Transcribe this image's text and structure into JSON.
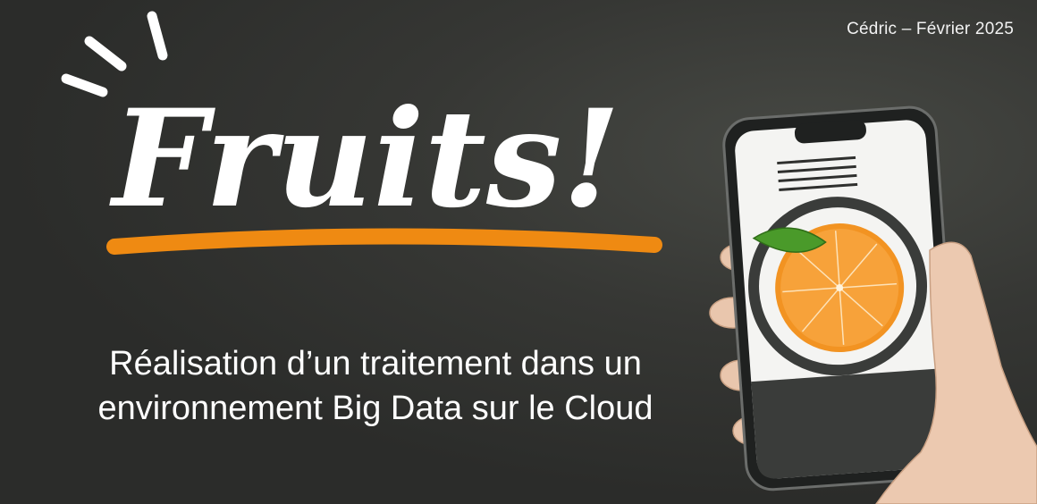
{
  "slide": {
    "author_date": "Cédric – Février 2025",
    "logo_text": "Fruits!",
    "subtitle_lines": [
      "Réalisation d’un traitement dans un",
      "environnement Big Data sur le Cloud"
    ]
  },
  "colors": {
    "background": "#2e2f2d",
    "logo_text": "#ffffff",
    "underline": "#ef8a12",
    "orange_fruit": "#f29322",
    "leaf": "#4a9a2a",
    "phone_body": "#1f2120",
    "screen_white": "#f4f4f2",
    "screen_dark": "#3a3c3a"
  },
  "icons": {
    "logo_burst": "sparkle-lines-icon",
    "phone_illustration": "phone-with-orange-icon"
  }
}
